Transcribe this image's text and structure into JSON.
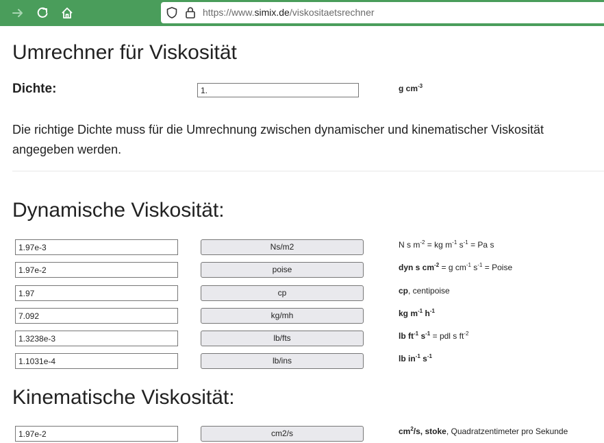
{
  "browser": {
    "url_prefix": "https://www.",
    "url_host": "simix.de",
    "url_path": "/viskositaetsrechner"
  },
  "page": {
    "title": "Umrechner für Viskosität",
    "density_label": "Dichte:",
    "density_value": "1.",
    "density_unit": "g cm",
    "density_unit_exp": "-3",
    "note": "Die richtige Dichte muss für die Umrechnung zwischen dynamischer und kinematischer Viskosität angegeben werden.",
    "dynamic_heading": "Dynamische Viskosität:",
    "kinematic_heading": "Kinematische Viskosität:"
  },
  "dynamic_rows": [
    {
      "value": "1.97e-3",
      "unit": "Ns/m2"
    },
    {
      "value": "1.97e-2",
      "unit": "poise"
    },
    {
      "value": "1.97",
      "unit": "cp"
    },
    {
      "value": "7.092",
      "unit": "kg/mh"
    },
    {
      "value": "1.3238e-3",
      "unit": "lb/fts"
    },
    {
      "value": "1.1031e-4",
      "unit": "lb/ins"
    }
  ],
  "kinematic_rows": [
    {
      "value": "1.97e-2",
      "unit": "cm2/s"
    }
  ],
  "descriptions": {
    "d0": {
      "a": "N s m",
      "a_exp": "-2",
      "b": " = kg m",
      "b_exp": "-1",
      "c": " s",
      "c_exp": "-1",
      "d": " = Pa s"
    },
    "d1": {
      "a": "dyn s cm",
      "a_exp": "-2",
      "b": " = g cm",
      "b_exp": "-1",
      "c": " s",
      "c_exp": "-1",
      "d": " = Poise"
    },
    "d2": {
      "a": "cp",
      "b": ", centipoise"
    },
    "d3": {
      "a": "kg m",
      "a_exp": "-1",
      "b": " h",
      "b_exp": "-1"
    },
    "d4": {
      "a": "lb ft",
      "a_exp": "-1",
      "b": " s",
      "b_exp": "-1",
      "c": " = pdl s ft",
      "c_exp": "-2"
    },
    "d5": {
      "a": "lb in",
      "a_exp": "-1",
      "b": " s",
      "b_exp": "-1"
    },
    "k0": {
      "a": "cm",
      "a_exp": "2",
      "b": "/s, stoke",
      "c": ", Quadratzentimeter pro Sekunde"
    }
  },
  "colors": {
    "browser_bar": "#4a9d5b",
    "button_bg": "#e9e9ed"
  },
  "icons": [
    "forward-arrow-icon",
    "reload-icon",
    "home-icon",
    "shield-icon",
    "lock-icon"
  ]
}
